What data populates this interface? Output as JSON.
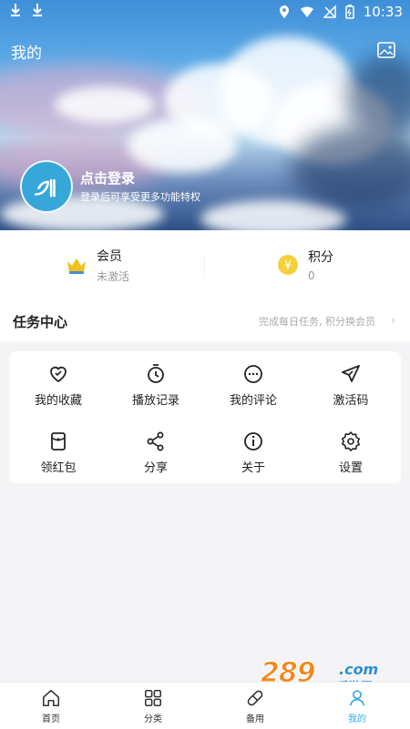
{
  "status_bar": {
    "time": "10:33"
  },
  "header": {
    "title": "我的"
  },
  "profile": {
    "login_title": "点击登录",
    "login_subtitle": "登录后可享受更多功能特权"
  },
  "stats": {
    "vip": {
      "label": "会员",
      "value": "未激活"
    },
    "points": {
      "label": "积分",
      "value": "0",
      "badge": "¥"
    }
  },
  "task_center": {
    "title": "任务中心",
    "hint": "完成每日任务, 积分换会员",
    "chevron": "›"
  },
  "grid": {
    "items": [
      {
        "label": "我的收藏",
        "icon": "heart-icon"
      },
      {
        "label": "播放记录",
        "icon": "clock-icon"
      },
      {
        "label": "我的评论",
        "icon": "comment-icon"
      },
      {
        "label": "激活码",
        "icon": "send-icon"
      },
      {
        "label": "领红包",
        "icon": "red-packet-icon"
      },
      {
        "label": "分享",
        "icon": "share-icon"
      },
      {
        "label": "关于",
        "icon": "info-icon"
      },
      {
        "label": "设置",
        "icon": "gear-icon"
      }
    ]
  },
  "bottom_nav": {
    "items": [
      {
        "label": "首页",
        "icon": "home-icon"
      },
      {
        "label": "分类",
        "icon": "grid-icon"
      },
      {
        "label": "备用",
        "icon": "pill-icon"
      },
      {
        "label": "我的",
        "icon": "user-icon",
        "active": true
      }
    ]
  },
  "watermark": {
    "number": "289",
    "domain": ".com",
    "text": "手游网"
  },
  "colors": {
    "accent": "#3aa8e8",
    "avatar": "#36a7d8",
    "gold": "#f2c01e",
    "watermark_orange": "#f08a1c",
    "watermark_blue": "#2e8fd6"
  }
}
